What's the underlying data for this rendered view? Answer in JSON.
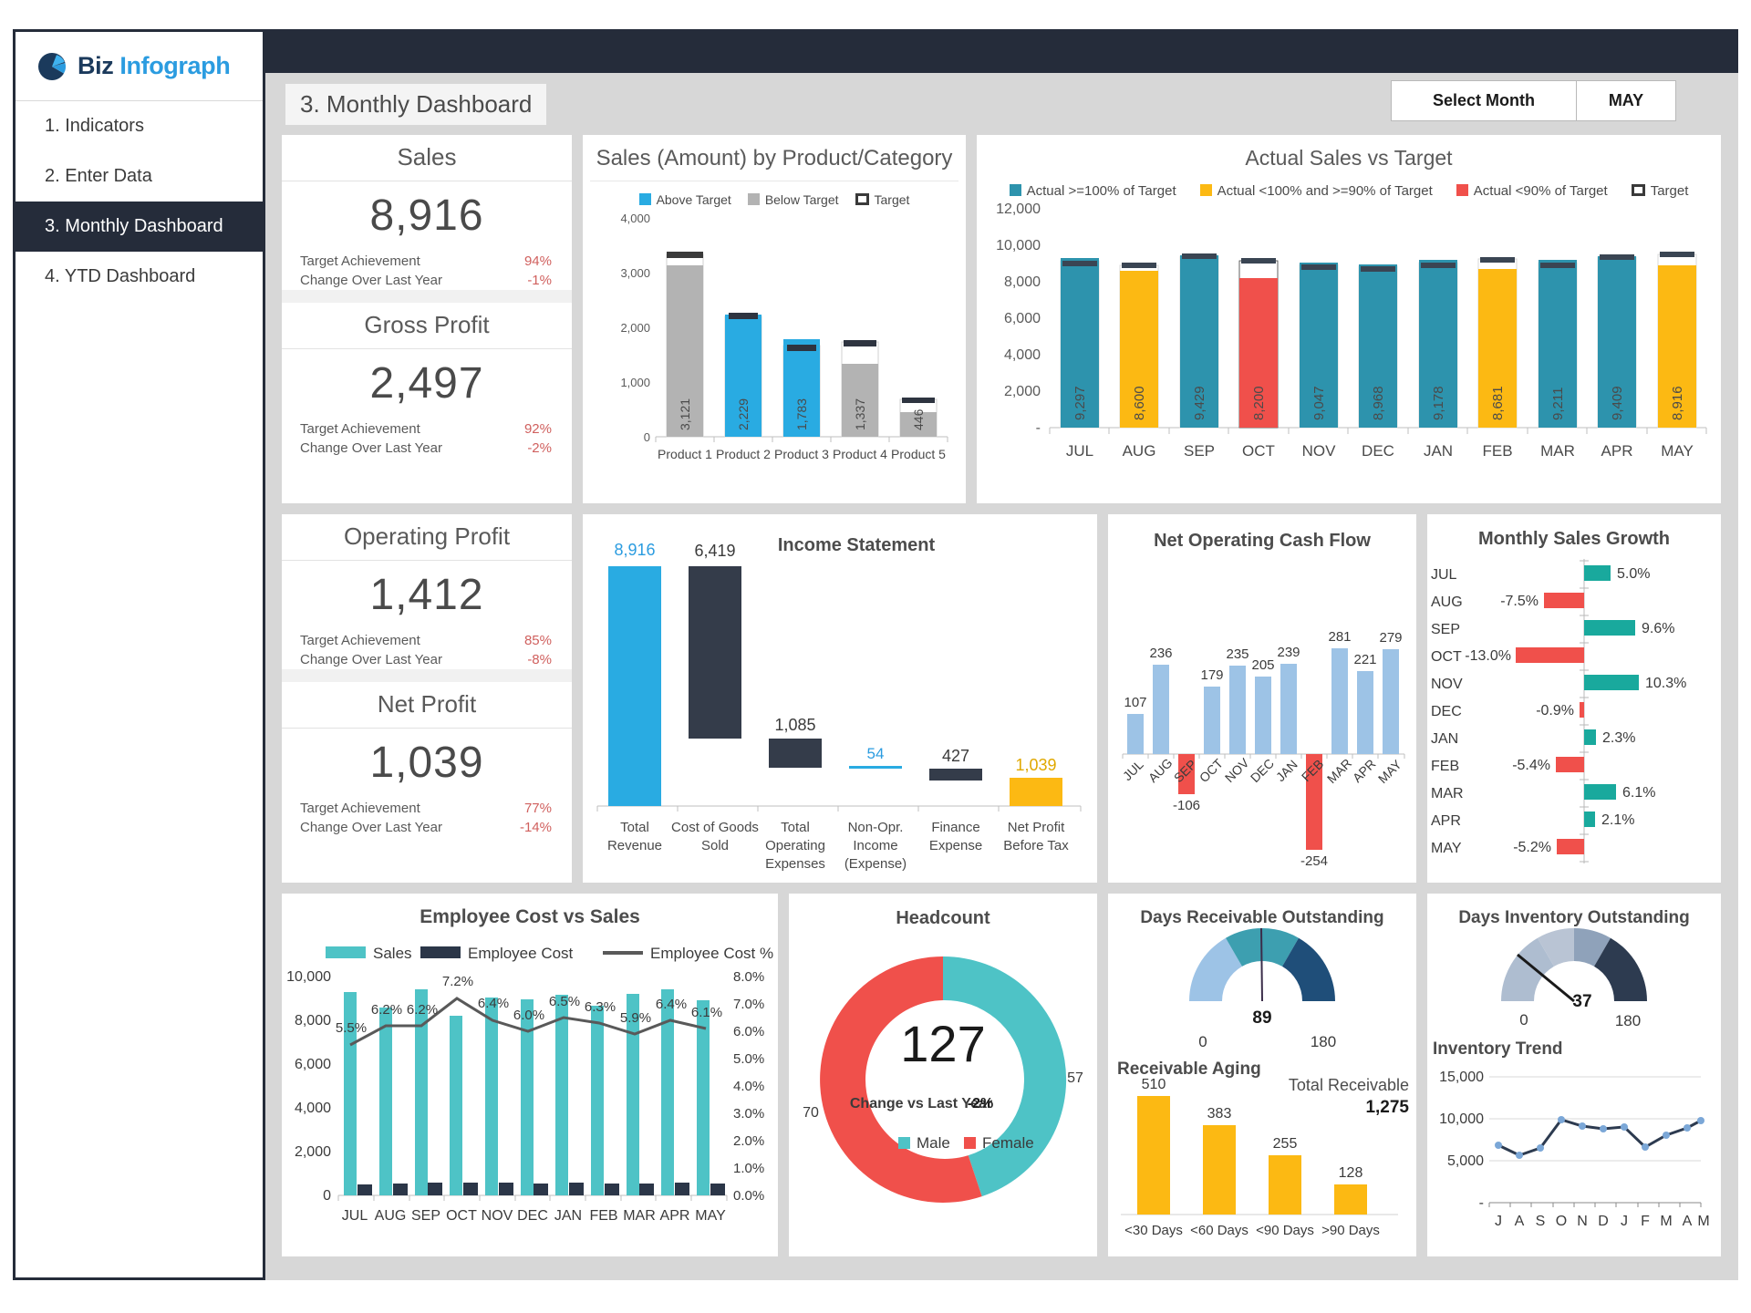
{
  "brand": {
    "name_1": "Biz",
    "name_2": "Infograph",
    "logo_icon": "pie-chart-icon"
  },
  "sidebar": {
    "items": [
      {
        "label": "1. Indicators",
        "active": false
      },
      {
        "label": "2. Enter Data",
        "active": false
      },
      {
        "label": "3. Monthly Dashboard",
        "active": true
      },
      {
        "label": "4. YTD Dashboard",
        "active": false
      }
    ]
  },
  "header": {
    "page_title": "3. Monthly Dashboard",
    "month_picker_label": "Select Month",
    "month_picker_value": "MAY"
  },
  "colors": {
    "dark_navy": "#252c3a",
    "blue": "#29abe2",
    "teal": "#2d93ad",
    "amber": "#fcb913",
    "red": "#f0504b",
    "grey": "#a6a6a6",
    "green_teal": "#19a99d",
    "cyan": "#4ec3c6",
    "light_blue": "#9dc3e6",
    "negative_text": "#d0605e"
  },
  "kpis": [
    {
      "title": "Sales",
      "value": "8,916",
      "rows": [
        {
          "label": "Target Achievement",
          "value": "94%"
        },
        {
          "label": "Change Over Last Year",
          "value": "-1%"
        }
      ]
    },
    {
      "title": "Gross Profit",
      "value": "2,497",
      "rows": [
        {
          "label": "Target Achievement",
          "value": "92%"
        },
        {
          "label": "Change Over Last Year",
          "value": "-2%"
        }
      ]
    },
    {
      "title": "Operating Profit",
      "value": "1,412",
      "rows": [
        {
          "label": "Target Achievement",
          "value": "85%"
        },
        {
          "label": "Change Over Last Year",
          "value": "-8%"
        }
      ]
    },
    {
      "title": "Net Profit",
      "value": "1,039",
      "rows": [
        {
          "label": "Target Achievement",
          "value": "77%"
        },
        {
          "label": "Change Over Last Year",
          "value": "-14%"
        }
      ]
    }
  ],
  "chart_data": [
    {
      "id": "sales_by_product",
      "type": "bar",
      "title": "Sales (Amount) by Product/Category",
      "legend": [
        "Above Target",
        "Below Target",
        "Target"
      ],
      "legend_position": "top",
      "categories": [
        "Product 1",
        "Product 2",
        "Product 3",
        "Product 4",
        "Product 5"
      ],
      "values": [
        3121,
        2229,
        1783,
        1337,
        446
      ],
      "targets": [
        3330,
        2200,
        1660,
        1740,
        680
      ],
      "status": [
        "below",
        "above",
        "above",
        "below",
        "below"
      ],
      "ylabel": "",
      "ylim": [
        0,
        4000
      ],
      "yticks": [
        "0",
        "1,000",
        "2,000",
        "3,000",
        "4,000"
      ],
      "grid": false
    },
    {
      "id": "actual_sales_vs_target",
      "type": "bar",
      "title": "Actual Sales vs Target",
      "legend": [
        "Actual >=100% of Target",
        "Actual <100% and >=90% of Target",
        "Actual <90% of Target",
        "Target"
      ],
      "legend_position": "top",
      "categories": [
        "JUL",
        "AUG",
        "SEP",
        "OCT",
        "NOV",
        "DEC",
        "JAN",
        "FEB",
        "MAR",
        "APR",
        "MAY"
      ],
      "values": [
        9297,
        8600,
        9429,
        8200,
        9047,
        8968,
        9178,
        8681,
        9211,
        9409,
        8916
      ],
      "targets": [
        9150,
        8900,
        9400,
        9150,
        8950,
        8850,
        9050,
        9250,
        9050,
        9350,
        9500
      ],
      "status": [
        "ge100",
        "lt100",
        "ge100",
        "lt90",
        "ge100",
        "ge100",
        "ge100",
        "lt100",
        "ge100",
        "ge100",
        "lt100"
      ],
      "ylim": [
        0,
        12000
      ],
      "yticks": [
        "-",
        "2,000",
        "4,000",
        "6,000",
        "8,000",
        "10,000",
        "12,000"
      ],
      "grid": false
    },
    {
      "id": "income_statement",
      "type": "bar",
      "title": "Income Statement",
      "categories": [
        "Total Revenue",
        "Cost of Goods Sold",
        "Total Operating Expenses",
        "Non-Opr. Income (Expense)",
        "Finance Expense",
        "Net Profit Before Tax"
      ],
      "category_lines": [
        [
          "Total",
          "Revenue"
        ],
        [
          "Cost of Goods",
          "Sold"
        ],
        [
          "Total",
          "Operating",
          "Expenses"
        ],
        [
          "Non-Opr.",
          "Income",
          "(Expense)"
        ],
        [
          "Finance",
          "Expense"
        ],
        [
          "Net Profit",
          "Before Tax"
        ]
      ],
      "labels": [
        "8,916",
        "6,419",
        "1,085",
        "54",
        "427",
        "1,039"
      ],
      "values": [
        8916,
        6419,
        1085,
        54,
        427,
        1039
      ],
      "bar_kind": [
        "total",
        "delta",
        "delta",
        "delta",
        "delta",
        "result"
      ],
      "ylim": [
        0,
        8916
      ]
    },
    {
      "id": "net_operating_cash_flow",
      "type": "bar",
      "title": "Net Operating Cash Flow",
      "categories": [
        "JUL",
        "AUG",
        "SEP",
        "OCT",
        "NOV",
        "DEC",
        "JAN",
        "FEB",
        "MAR",
        "APR",
        "MAY"
      ],
      "values": [
        107,
        236,
        -106,
        179,
        235,
        205,
        239,
        -254,
        281,
        221,
        279
      ],
      "ylim": [
        -254,
        281
      ],
      "grid": false
    },
    {
      "id": "monthly_sales_growth",
      "type": "bar",
      "orientation": "horizontal",
      "title": "Monthly Sales Growth",
      "categories": [
        "JUL",
        "AUG",
        "SEP",
        "OCT",
        "NOV",
        "DEC",
        "JAN",
        "FEB",
        "MAR",
        "APR",
        "MAY"
      ],
      "values": [
        5.0,
        -7.5,
        9.6,
        -13.0,
        10.3,
        -0.9,
        2.3,
        -5.4,
        6.1,
        2.1,
        -5.2
      ],
      "labels": [
        "5.0%",
        "-7.5%",
        "9.6%",
        "-13.0%",
        "10.3%",
        "-0.9%",
        "2.3%",
        "-5.4%",
        "6.1%",
        "2.1%",
        "-5.2%"
      ],
      "xlim": [
        -13.0,
        10.3
      ]
    },
    {
      "id": "employee_cost_vs_sales",
      "type": "bar",
      "title": "Employee Cost vs Sales",
      "legend": [
        "Sales",
        "Employee Cost",
        "Employee Cost %"
      ],
      "categories": [
        "JUL",
        "AUG",
        "SEP",
        "OCT",
        "NOV",
        "DEC",
        "JAN",
        "FEB",
        "MAR",
        "APR",
        "MAY"
      ],
      "series": [
        {
          "name": "Sales",
          "values": [
            9297,
            8600,
            9429,
            8200,
            9047,
            8968,
            9178,
            8681,
            9211,
            9409,
            8916
          ]
        },
        {
          "name": "Employee Cost",
          "values": [
            511,
            533,
            585,
            590,
            579,
            538,
            597,
            547,
            543,
            602,
            544
          ]
        },
        {
          "name": "Employee Cost %",
          "values": [
            5.5,
            6.2,
            6.2,
            7.2,
            6.4,
            6.0,
            6.5,
            6.3,
            5.9,
            6.4,
            6.1
          ]
        }
      ],
      "line_labels": [
        "5.5%",
        "6.2%",
        "6.2%",
        "7.2%",
        "6.4%",
        "6.0%",
        "6.5%",
        "6.3%",
        "5.9%",
        "6.4%",
        "6.1%"
      ],
      "yticks_left": [
        "0",
        "2,000",
        "4,000",
        "6,000",
        "8,000",
        "10,000"
      ],
      "yticks_right": [
        "0.0%",
        "1.0%",
        "2.0%",
        "3.0%",
        "4.0%",
        "5.0%",
        "6.0%",
        "7.0%",
        "8.0%"
      ],
      "ylim_left": [
        0,
        10000
      ],
      "ylim_right": [
        0,
        8.0
      ]
    },
    {
      "id": "headcount",
      "type": "pie",
      "title": "Headcount",
      "center_value": "127",
      "change_label": "Change vs Last Year",
      "change_value": "-2%",
      "legend": [
        "Male",
        "Female"
      ],
      "slices": [
        {
          "name": "Male",
          "value": 57,
          "label": "57"
        },
        {
          "name": "Female",
          "value": 70,
          "label": "70"
        }
      ]
    },
    {
      "id": "days_receivable_outstanding",
      "type": "gauge",
      "title": "Days Receivable Outstanding",
      "value": 89,
      "value_label": "89",
      "min_label": "0",
      "max_label": "180",
      "range": [
        0,
        180
      ]
    },
    {
      "id": "receivable_aging",
      "type": "bar",
      "title": "Receivable Aging",
      "total_label": "Total Receivable",
      "total_value": "1,275",
      "categories": [
        "<30 Days",
        "<60 Days",
        "<90 Days",
        ">90 Days"
      ],
      "values": [
        510,
        383,
        255,
        128
      ],
      "labels": [
        "510",
        "383",
        "255",
        "128"
      ],
      "ylim": [
        0,
        510
      ]
    },
    {
      "id": "days_inventory_outstanding",
      "type": "gauge",
      "title": "Days Inventory Outstanding",
      "value": 37,
      "value_label": "37",
      "min_label": "0",
      "max_label": "180",
      "range": [
        0,
        180
      ]
    },
    {
      "id": "inventory_trend",
      "type": "line",
      "title": "Inventory Trend",
      "categories": [
        "J",
        "A",
        "S",
        "O",
        "N",
        "D",
        "J",
        "F",
        "M",
        "A",
        "M"
      ],
      "values": [
        6800,
        5700,
        6500,
        9900,
        9100,
        8800,
        9000,
        6600,
        8000,
        8900,
        9800
      ],
      "yticks": [
        "-",
        "5,000",
        "10,000",
        "15,000"
      ],
      "ylim": [
        0,
        15000
      ],
      "grid": true
    }
  ]
}
